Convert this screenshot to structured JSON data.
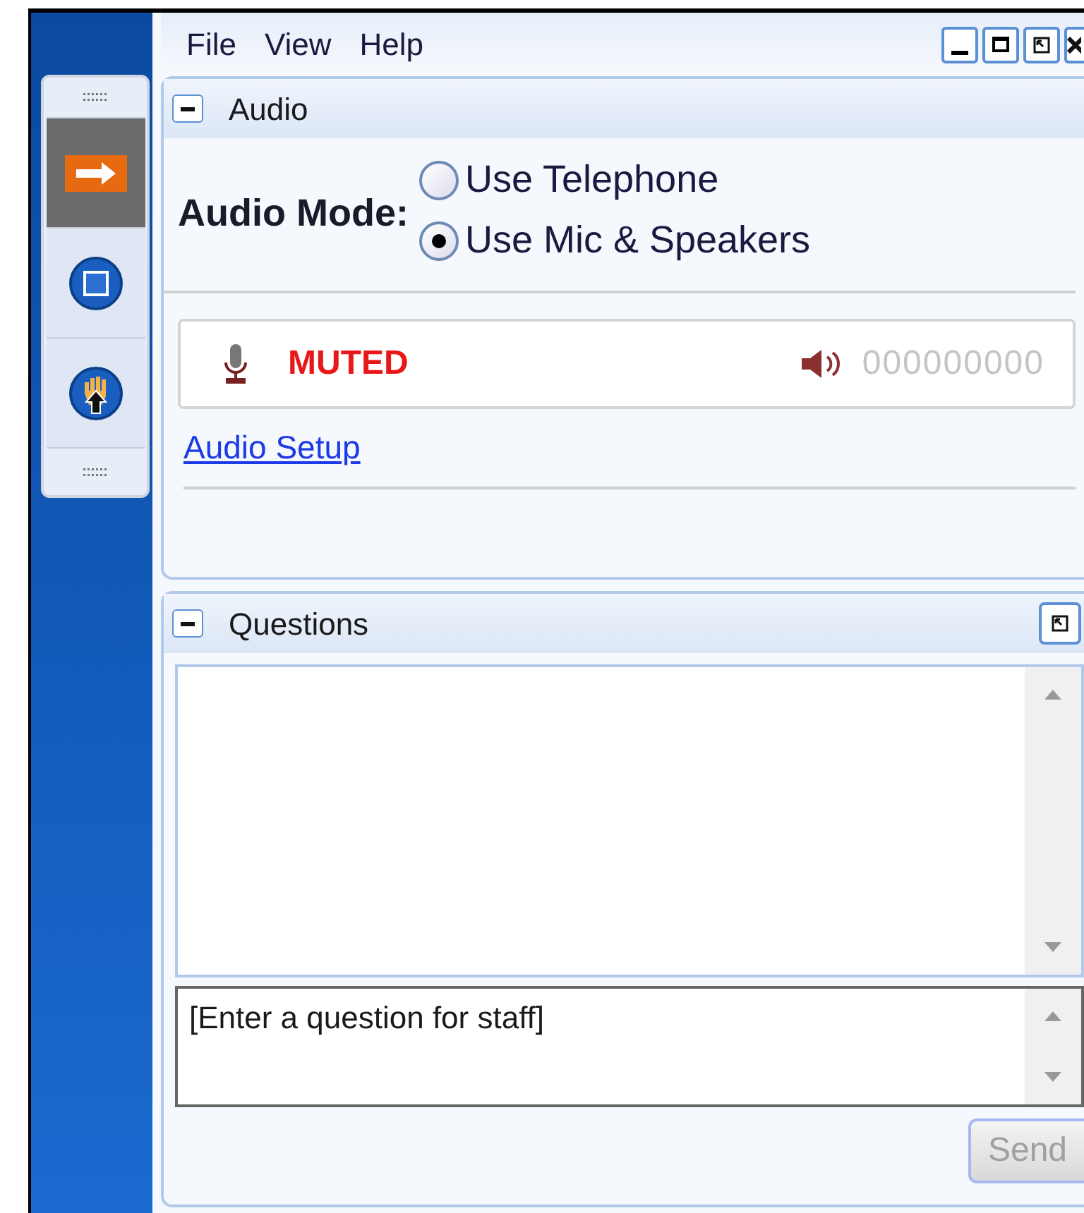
{
  "toolbar": {
    "items": [
      {
        "kind": "arrow",
        "selected": true
      },
      {
        "kind": "stop",
        "selected": false
      },
      {
        "kind": "hand",
        "selected": false
      }
    ]
  },
  "menu": [
    "File",
    "View",
    "Help"
  ],
  "audio": {
    "title": "Audio",
    "mode_label": "Audio Mode:",
    "options": [
      {
        "label": "Use Telephone",
        "selected": false
      },
      {
        "label": "Use Mic & Speakers",
        "selected": true
      }
    ],
    "mic_status": "MUTED",
    "speaker_level": "000000000",
    "setup_link": "Audio Setup"
  },
  "questions": {
    "title": "Questions",
    "input": {
      "placeholder": "[Enter a question for staff]"
    },
    "send": {
      "label": "Send",
      "disabled": true
    }
  }
}
